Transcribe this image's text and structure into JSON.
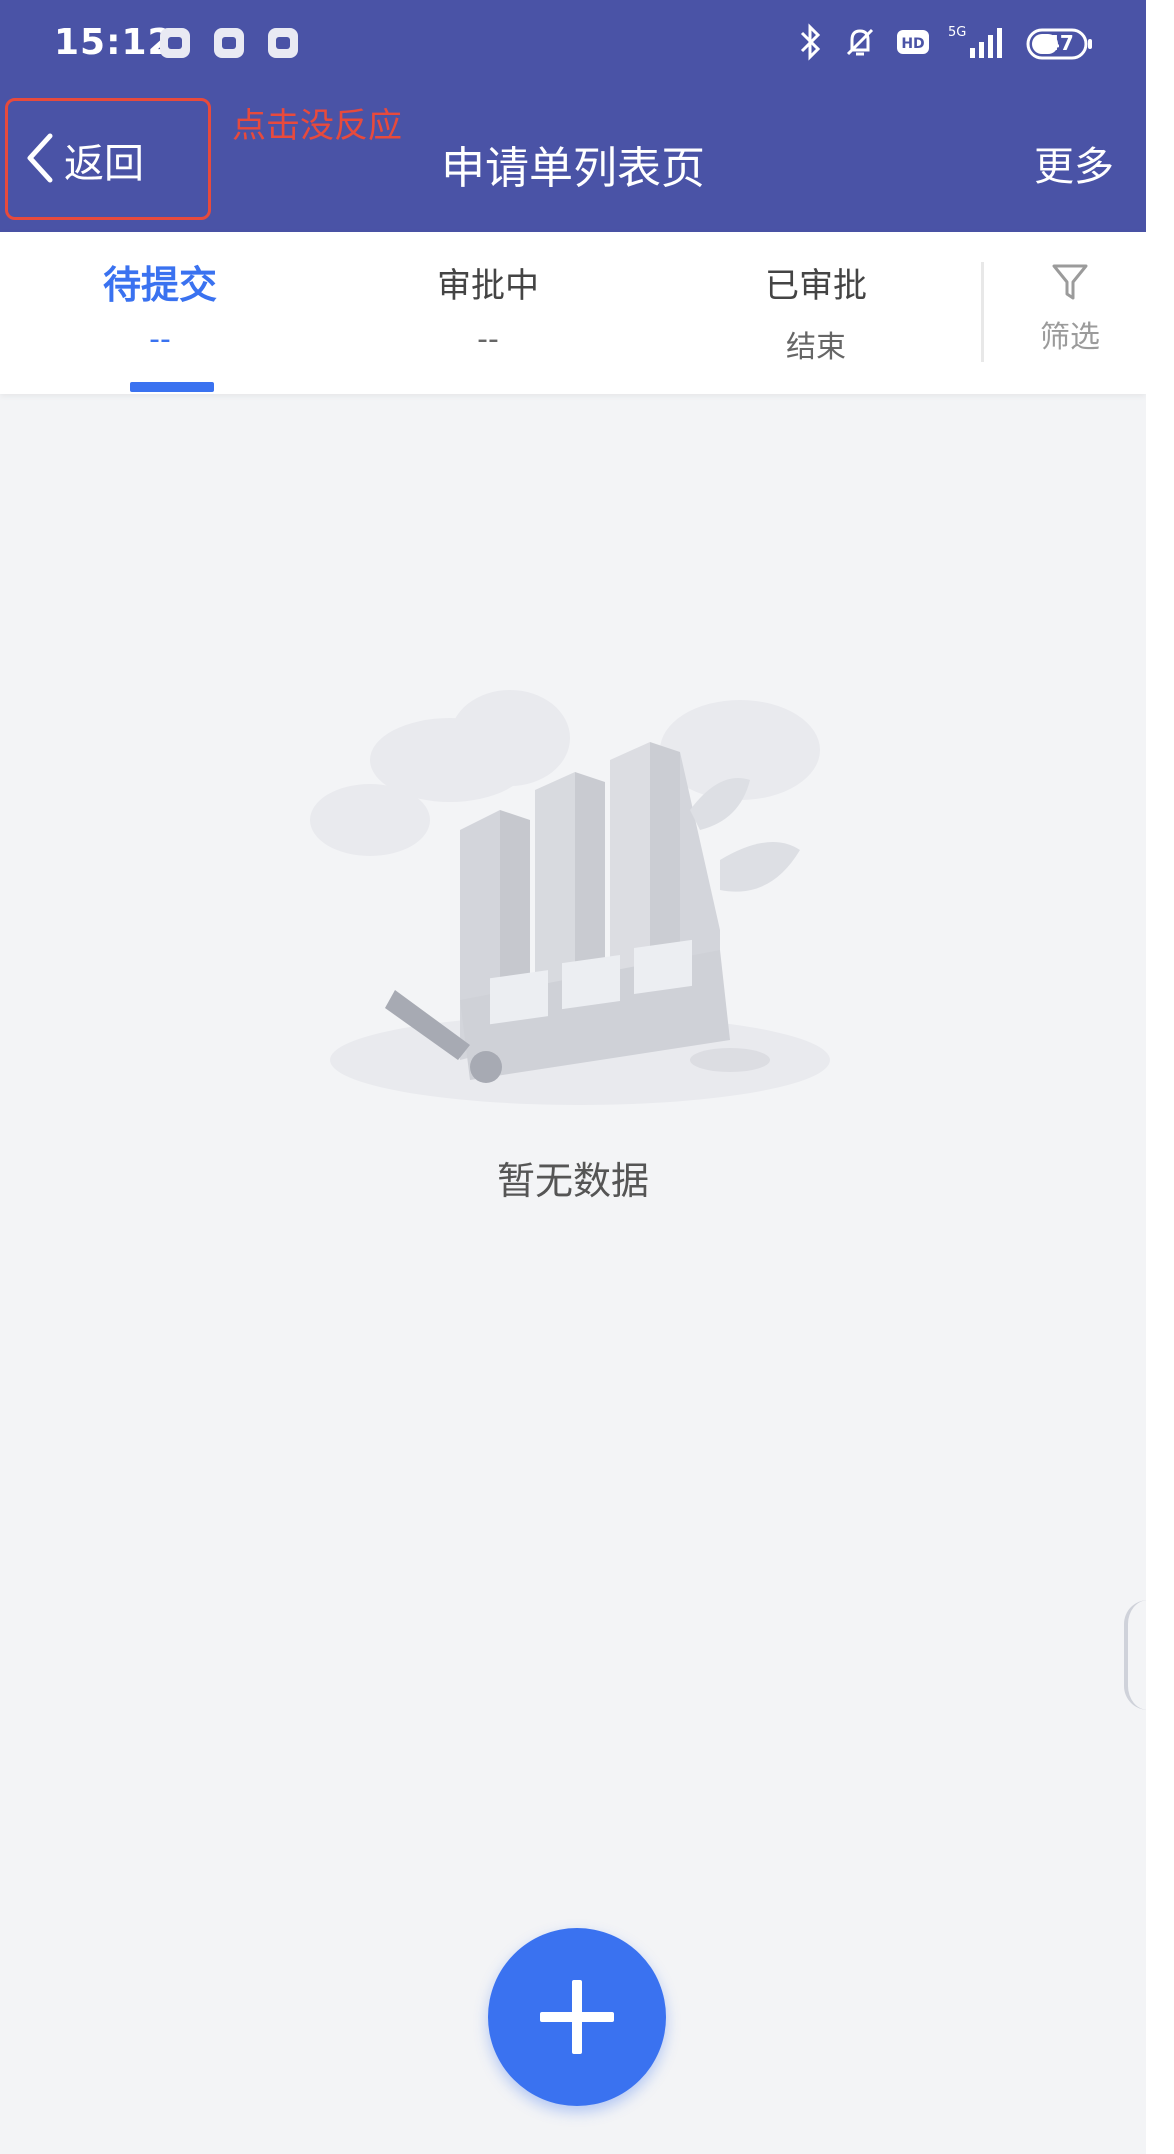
{
  "status_bar": {
    "time": "15:12",
    "battery": "47",
    "network": "5G"
  },
  "nav": {
    "back_label": "返回",
    "title": "申请单列表页",
    "more_label": "更多"
  },
  "annotation": {
    "text": "点击没反应",
    "color": "#e84a3c"
  },
  "tabs": [
    {
      "title": "待提交",
      "sub": "--",
      "active": true
    },
    {
      "title": "审批中",
      "sub": "--",
      "active": false
    },
    {
      "title": "已审批",
      "sub": "结束",
      "active": false
    }
  ],
  "filter": {
    "label": "筛选"
  },
  "empty": {
    "text": "暂无数据"
  },
  "colors": {
    "header": "#4a53a6",
    "accent": "#3a72f0",
    "background": "#f3f4f6"
  }
}
